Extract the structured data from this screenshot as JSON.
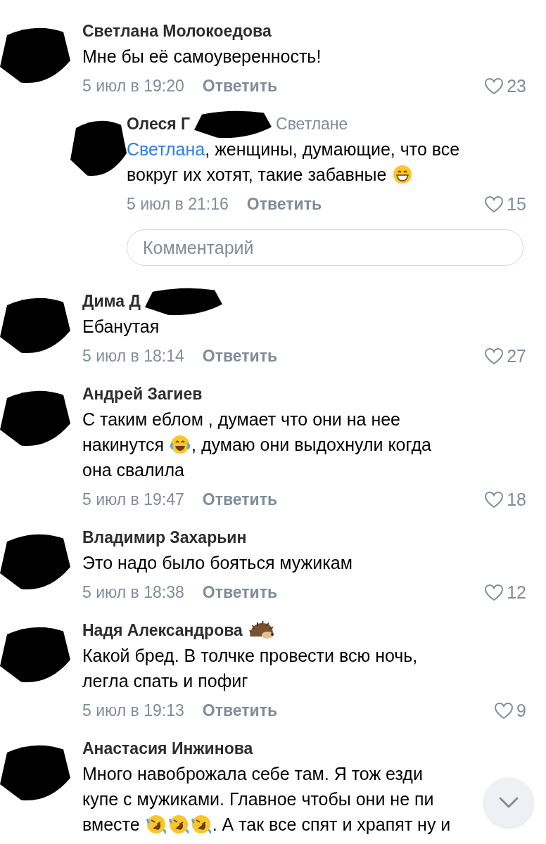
{
  "comments": [
    {
      "name": "Светлана Молокоедова",
      "name_redacted": false,
      "reply": false,
      "lines": [
        [
          {
            "kind": "text",
            "text": "Мне бы её самоуверенность!"
          }
        ]
      ],
      "date": "5 июл в 19:20",
      "reply_label": "Ответить",
      "likes": "23"
    },
    {
      "name": "Олеся Г",
      "name_redacted": true,
      "reply": true,
      "reply_to": "Светлане",
      "lines": [
        [
          {
            "kind": "link",
            "text": "Светлана"
          },
          {
            "kind": "text",
            "text": ", женщины, думающие, что все"
          }
        ],
        [
          {
            "kind": "text",
            "text": "вокруг их хотят, такие забавные "
          },
          {
            "kind": "grin"
          }
        ]
      ],
      "date": "5 июл в 21:16",
      "reply_label": "Ответить",
      "likes": "15"
    },
    {
      "kind": "field",
      "placeholder": "Комментарий"
    },
    {
      "name": "Дима Д",
      "name_redacted": true,
      "reply": false,
      "lines": [
        [
          {
            "kind": "text",
            "text": "Ебанутая"
          }
        ]
      ],
      "date": "5 июл в 18:14",
      "reply_label": "Ответить",
      "likes": "27"
    },
    {
      "name": "Андрей Загиев",
      "name_redacted": false,
      "reply": false,
      "lines": [
        [
          {
            "kind": "text",
            "text": "С таким еблом , думает что они на нее"
          }
        ],
        [
          {
            "kind": "text",
            "text": "накинутся "
          },
          {
            "kind": "laugh"
          },
          {
            "kind": "text",
            "text": ", думаю они выдохнули когда"
          }
        ],
        [
          {
            "kind": "text",
            "text": "она свалила"
          }
        ]
      ],
      "date": "5 июл в 19:47",
      "reply_label": "Ответить",
      "likes": "18"
    },
    {
      "name": "Владимир Захарьин",
      "name_redacted": false,
      "reply": false,
      "lines": [
        [
          {
            "kind": "text",
            "text": "Это надо было бояться мужикам"
          }
        ]
      ],
      "date": "5 июл в 18:38",
      "reply_label": "Ответить",
      "likes": "12"
    },
    {
      "name": "Надя Александрова",
      "name_redacted": false,
      "name_icons": [
        {
          "kind": "hedgehog"
        }
      ],
      "reply": false,
      "lines": [
        [
          {
            "kind": "text",
            "text": "Какой бред. В толчке провести всю ночь,"
          }
        ],
        [
          {
            "kind": "text",
            "text": "легла спать и пофиг"
          }
        ]
      ],
      "date": "5 июл в 19:13",
      "reply_label": "Ответить",
      "likes": "9"
    },
    {
      "name": "Анастасия Инжинова",
      "name_redacted": false,
      "reply": false,
      "lines": [
        [
          {
            "kind": "text",
            "text": "Много навоброжала себе там. Я тож езди"
          }
        ],
        [
          {
            "kind": "text",
            "text": "купе с мужиками. Главное чтобы они не пи"
          }
        ],
        [
          {
            "kind": "text",
            "text": "вместе "
          },
          {
            "kind": "rofl"
          },
          {
            "kind": "rofl"
          },
          {
            "kind": "rofl"
          },
          {
            "kind": "text",
            "text": ". А так все спят и храпят ну и"
          }
        ]
      ]
    }
  ],
  "scroll_button": {
    "visible": true
  }
}
